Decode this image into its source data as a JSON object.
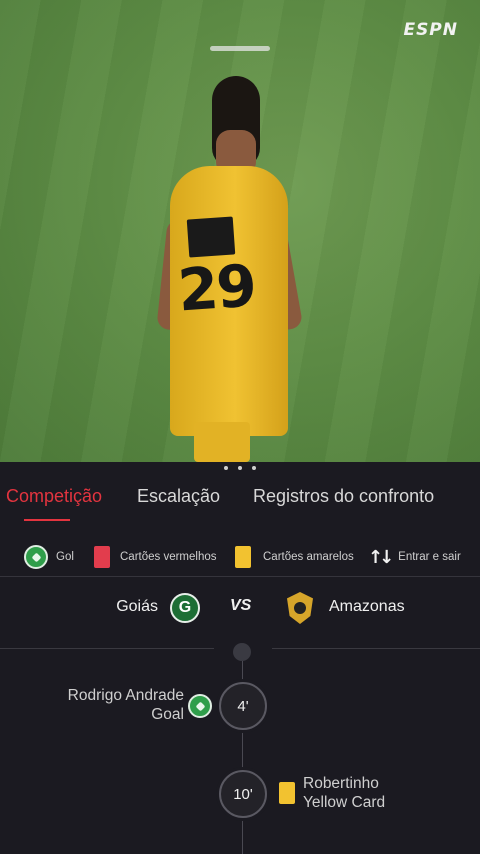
{
  "video": {
    "broadcaster": "ESPN",
    "jersey_number": "29"
  },
  "tabs": [
    {
      "label": "Competição",
      "active": true
    },
    {
      "label": "Escalação",
      "active": false
    },
    {
      "label": "Registros do confronto",
      "active": false
    }
  ],
  "legend": [
    {
      "icon": "soccer-ball-icon",
      "label": "Gol"
    },
    {
      "icon": "red-card-icon",
      "label": "Cartões vermelhos"
    },
    {
      "icon": "yellow-card-icon",
      "label": "Cartões amarelos"
    },
    {
      "icon": "swap-arrows-icon",
      "label": "Entrar e sair"
    }
  ],
  "match": {
    "home_team": "Goiás",
    "home_crest_letter": "G",
    "vs": "VS",
    "away_team": "Amazonas"
  },
  "events": [
    {
      "minute": "4'",
      "side": "home",
      "player": "Rodrigo Andrade",
      "type": "Goal",
      "icon": "soccer-ball-icon"
    },
    {
      "minute": "10'",
      "side": "away",
      "player": "Robertinho",
      "type": "Yellow Card",
      "icon": "yellow-card-icon"
    }
  ],
  "colors": {
    "accent": "#e3343f",
    "panel_bg": "#1b1a21",
    "goal_green": "#2f9e4a",
    "yellow_card": "#f2c230",
    "red_card": "#e23d4d"
  }
}
